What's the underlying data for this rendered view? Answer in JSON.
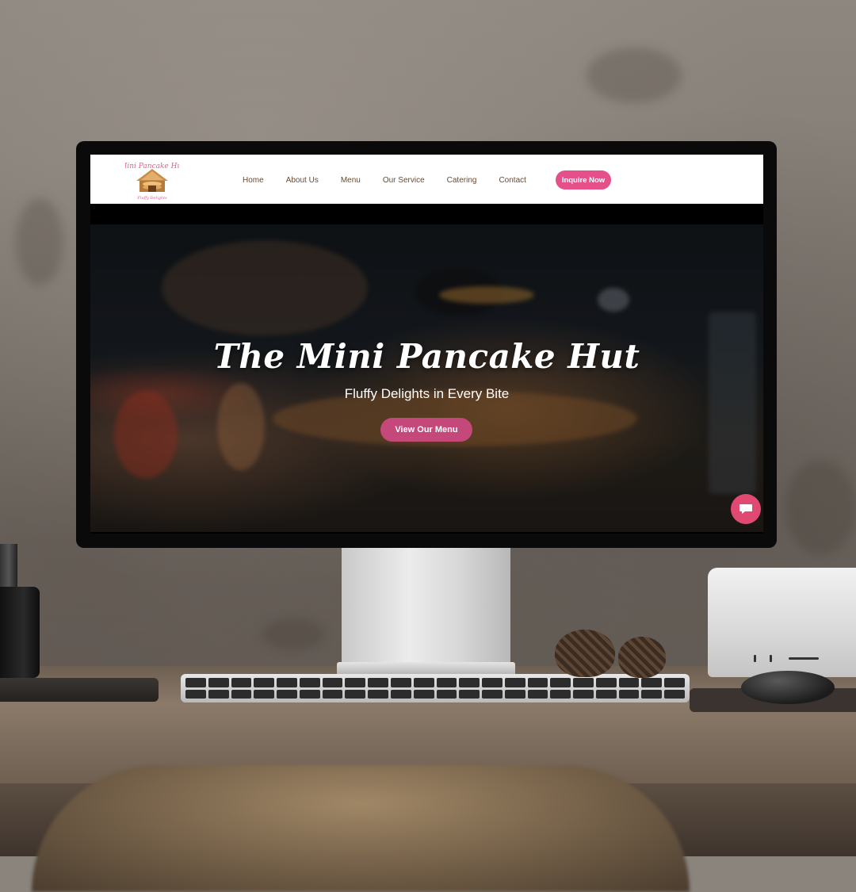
{
  "brand": {
    "logo_text": "Mini Pancake Hut",
    "logo_tagline": "Fluffy Delights",
    "accent_color": "#e5508a",
    "nav_text_color": "#6b4a2e"
  },
  "nav": {
    "items": [
      {
        "label": "Home"
      },
      {
        "label": "About Us"
      },
      {
        "label": "Menu"
      },
      {
        "label": "Our Service"
      },
      {
        "label": "Catering"
      },
      {
        "label": "Contact"
      }
    ],
    "cta_label": "Inquire Now"
  },
  "hero": {
    "title": "The Mini Pancake Hut",
    "subtitle": "Fluffy Delights in Every Bite",
    "button_label": "View Our Menu",
    "button_color": "#c4497a"
  },
  "chat": {
    "icon": "chat-bubble-icon",
    "color": "#e04a72"
  }
}
